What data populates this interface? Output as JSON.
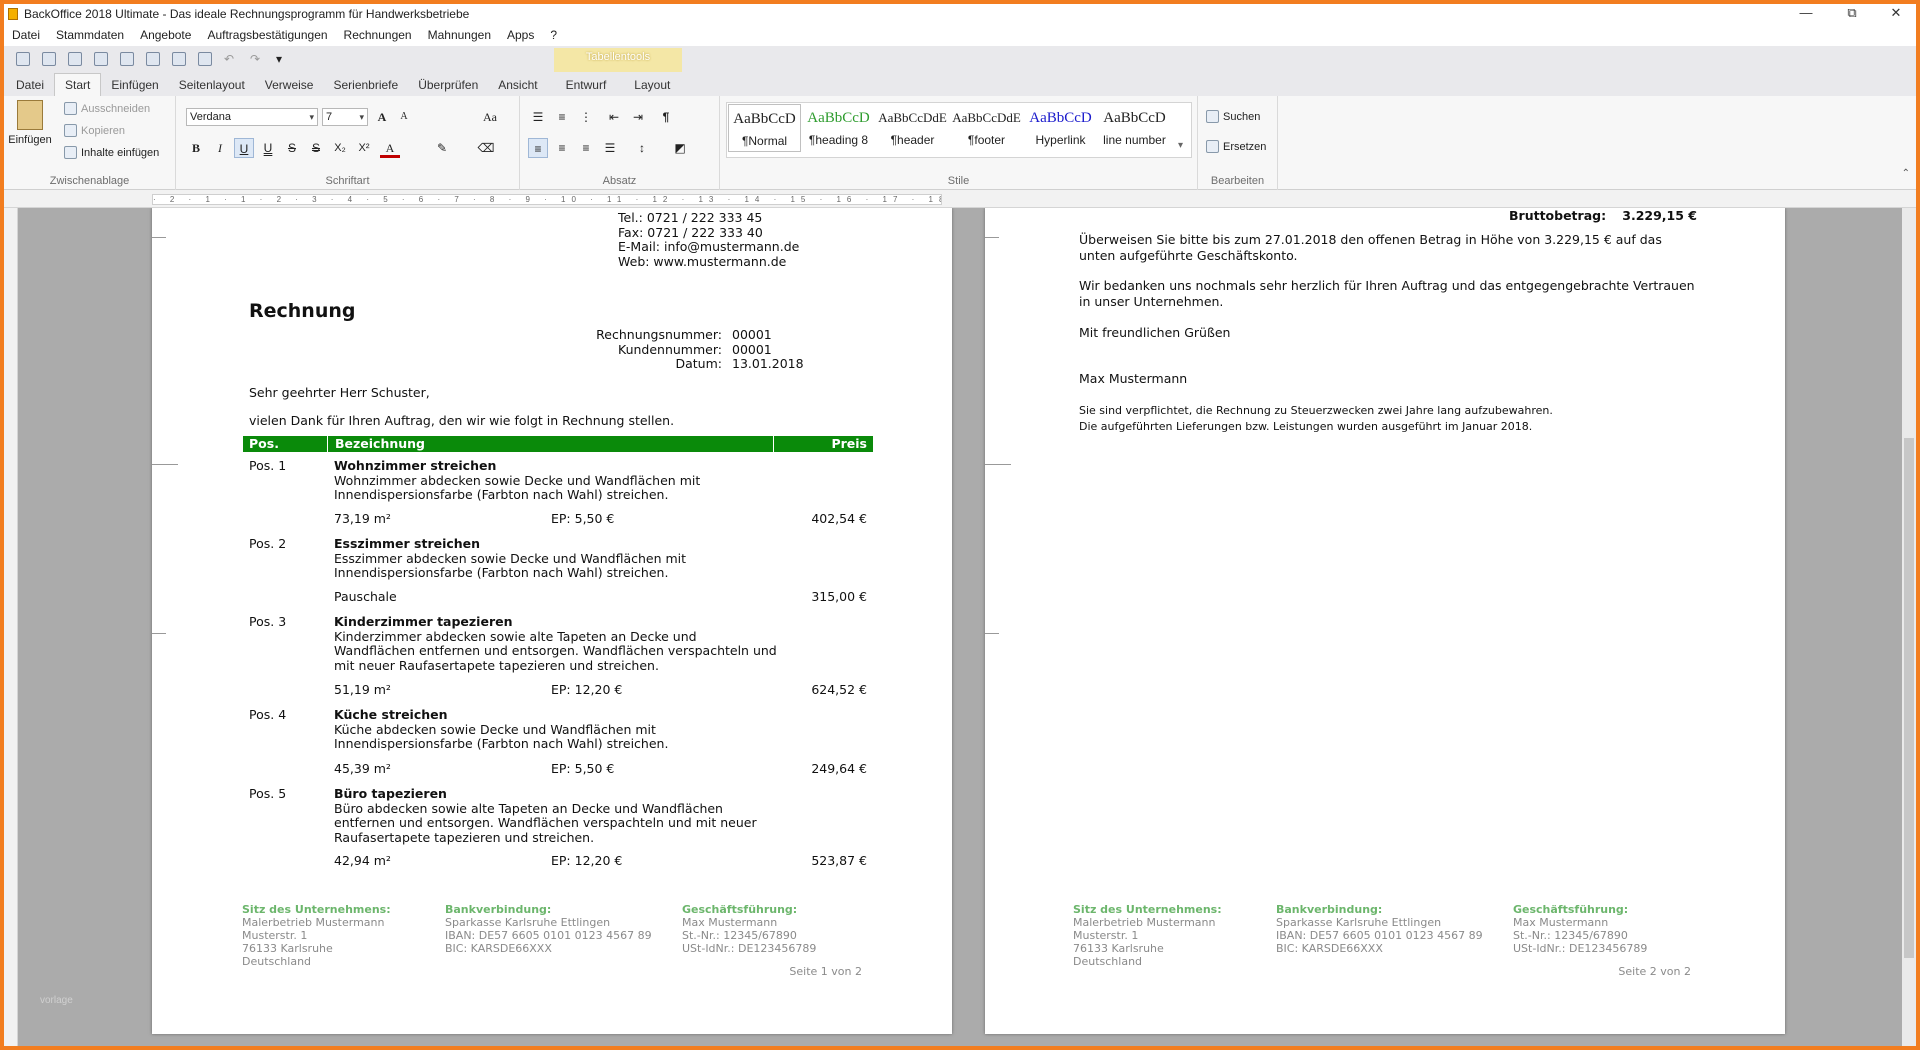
{
  "window": {
    "title": "BackOffice 2018 Ultimate - Das ideale Rechnungsprogramm für Handwerksbetriebe",
    "controls": {
      "minimize": "—",
      "maximize": "⧉",
      "close": "✕"
    }
  },
  "menu": [
    "Datei",
    "Stammdaten",
    "Angebote",
    "Auftragsbestätigungen",
    "Rechnungen",
    "Mahnungen",
    "Apps",
    "?"
  ],
  "ribbon": {
    "context_group": "Tabellentools",
    "tabs": [
      "Datei",
      "Start",
      "Einfügen",
      "Seitenlayout",
      "Verweise",
      "Serienbriefe",
      "Überprüfen",
      "Ansicht",
      "Entwurf",
      "Layout"
    ],
    "active_tab": "Start",
    "clipboard": {
      "paste": "Einfügen",
      "cut": "Ausschneiden",
      "copy": "Kopieren",
      "paste_special": "Inhalte einfügen",
      "label": "Zwischenablage"
    },
    "font": {
      "name": "Verdana",
      "size": "7",
      "label": "Schriftart",
      "grow": "A",
      "shrink": "A",
      "case": "Aa",
      "bold": "B",
      "italic": "I",
      "underline": "U",
      "underline2": "U",
      "strike": "S",
      "strike2": "S",
      "subscript": "X₂",
      "superscript": "X²",
      "color": "A"
    },
    "paragraph": {
      "label": "Absatz",
      "pilcrow": "¶"
    },
    "styles": {
      "label": "Stile",
      "items": [
        {
          "preview": "AaBbCcD",
          "name": "¶Normal",
          "color": "#000000"
        },
        {
          "preview": "AaBbCcD",
          "name": "¶heading 8",
          "color": "#2e9c2e"
        },
        {
          "preview": "AaBbCcDdE",
          "name": "¶header",
          "color": "#000000"
        },
        {
          "preview": "AaBbCcDdE",
          "name": "¶footer",
          "color": "#000000"
        },
        {
          "preview": "AaBbCcD",
          "name": "Hyperlink",
          "color": "#1a1acc"
        },
        {
          "preview": "AaBbCcD",
          "name": "line number",
          "color": "#000000"
        }
      ]
    },
    "edit": {
      "label": "Bearbeiten",
      "find": "Suchen",
      "replace": "Ersetzen"
    }
  },
  "ruler_text": "· 2 · 1 · 1 · 2 · 3 · 4 · 5 · 6 · 7 · 8 · 9 · 10 · 11 · 12 · 13 · 14 · 15 · 16 · 17 · 18 ·",
  "page1": {
    "header": {
      "tel": "Tel.: 0721 / 222 333 45",
      "fax": "Fax: 0721 / 222 333 40",
      "email": "E-Mail: info@mustermann.de",
      "web": "Web: www.mustermann.de"
    },
    "title": "Rechnung",
    "meta": [
      {
        "label": "Rechnungsnummer:",
        "value": "00001"
      },
      {
        "label": "Kundennummer:",
        "value": "00001"
      },
      {
        "label": "Datum:",
        "value": "13.01.2018"
      }
    ],
    "salutation": "Sehr geehrter Herr Schuster,",
    "intro": "vielen Dank für Ihren Auftrag, den wir wie folgt in Rechnung stellen.",
    "table_headers": {
      "pos": "Pos.",
      "desc": "Bezeichnung",
      "price": "Preis"
    },
    "positions": [
      {
        "pos": "Pos. 1",
        "title": "Wohnzimmer streichen",
        "lines": [
          "Wohnzimmer abdecken sowie Decke und Wandflächen mit",
          "Innendispersionsfarbe (Farbton nach Wahl) streichen."
        ],
        "qty": "73,19 m²",
        "ep": "EP: 5,50 €",
        "total": "402,54 €"
      },
      {
        "pos": "Pos. 2",
        "title": "Esszimmer streichen",
        "lines": [
          "Esszimmer abdecken sowie Decke und Wandflächen mit",
          "Innendispersionsfarbe (Farbton nach Wahl) streichen."
        ],
        "qty": "Pauschale",
        "ep": "",
        "total": "315,00 €"
      },
      {
        "pos": "Pos. 3",
        "title": "Kinderzimmer tapezieren",
        "lines": [
          "Kinderzimmer abdecken sowie alte Tapeten an Decke und",
          "Wandflächen entfernen und entsorgen. Wandflächen verspachteln und",
          "mit neuer Raufasertapete tapezieren und streichen."
        ],
        "qty": "51,19 m²",
        "ep": "EP: 12,20 €",
        "total": "624,52 €"
      },
      {
        "pos": "Pos. 4",
        "title": "Küche streichen",
        "lines": [
          "Küche abdecken sowie Decke und Wandflächen mit",
          "Innendispersionsfarbe (Farbton nach Wahl) streichen."
        ],
        "qty": "45,39 m²",
        "ep": "EP: 5,50 €",
        "total": "249,64 €"
      },
      {
        "pos": "Pos. 5",
        "title": "Büro tapezieren",
        "lines": [
          "Büro abdecken sowie alte Tapeten an Decke und Wandflächen",
          "entfernen und entsorgen. Wandflächen verspachteln und mit neuer",
          "Raufasertapete tapezieren und streichen."
        ],
        "qty": "42,94 m²",
        "ep": "EP: 12,20 €",
        "total": "523,87 €"
      }
    ],
    "page_number": "Seite 1 von 2"
  },
  "footer": {
    "seat": {
      "head": "Sitz des Unternehmens:",
      "lines": [
        "Malerbetrieb Mustermann",
        "Musterstr. 1",
        "76133 Karlsruhe",
        "Deutschland"
      ]
    },
    "bank": {
      "head": "Bankverbindung:",
      "lines": [
        "Sparkasse Karlsruhe Ettlingen",
        "IBAN: DE57 6605 0101 0123 4567 89",
        "BIC: KARSDE66XXX"
      ]
    },
    "mgmt": {
      "head": "Geschäftsführung:",
      "lines": [
        "Max Mustermann",
        "St.-Nr.: 12345/67890",
        "USt-IdNr.: DE123456789"
      ]
    }
  },
  "page2": {
    "gross_label": "Bruttobetrag:",
    "gross_value": "3.229,15 €",
    "pay_line1": "Überweisen Sie bitte bis zum 27.01.2018 den offenen Betrag in Höhe von 3.229,15 € auf das",
    "pay_line2": "unten aufgeführte Geschäftskonto.",
    "thanks_line1": "Wir bedanken uns nochmals sehr herzlich für Ihren Auftrag und das entgegengebrachte Vertrauen",
    "thanks_line2": "in unser Unternehmen.",
    "closing": "Mit freundlichen Grüßen",
    "signature": "Max Mustermann",
    "note1": "Sie sind verpflichtet, die Rechnung zu Steuerzwecken zwei Jahre lang aufzubewahren.",
    "note2": "Die aufgeführten Lieferungen bzw. Leistungen wurden ausgeführt im Januar 2018.",
    "page_number": "Seite 2 von 2"
  },
  "watermark": "vorlage"
}
